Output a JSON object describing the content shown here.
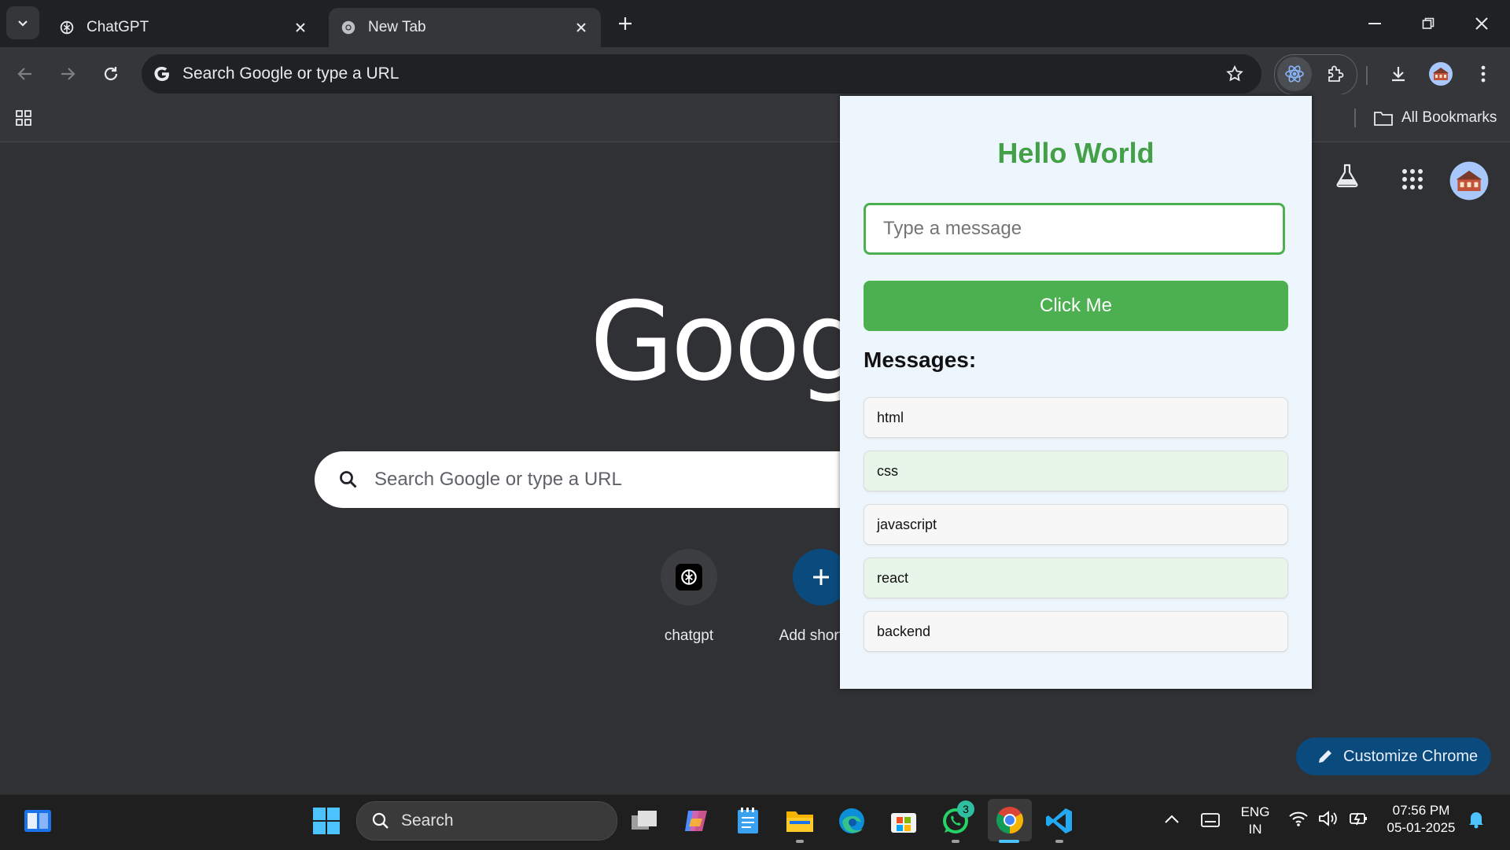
{
  "browser": {
    "tabs": [
      {
        "title": "ChatGPT",
        "active": false
      },
      {
        "title": "New Tab",
        "active": true
      }
    ],
    "omnibox_text": "Search Google or type a URL",
    "bookmarks_label": "All Bookmarks"
  },
  "ntp": {
    "logo_text": "Google",
    "search_placeholder": "Search Google or type a URL",
    "shortcuts": [
      {
        "label": "chatgpt"
      },
      {
        "label": "Add shortcut"
      }
    ],
    "customize_label": "Customize Chrome"
  },
  "popup": {
    "title": "Hello World",
    "input_placeholder": "Type a message",
    "button_label": "Click Me",
    "messages_heading": "Messages:",
    "messages": [
      "html",
      "css",
      "javascript",
      "react",
      "backend"
    ],
    "colors": {
      "accent": "#4caf50",
      "title": "#43a047",
      "background": "#eef6fd",
      "item_odd": "#f7f7f7",
      "item_even": "#e8f5e9"
    }
  },
  "taskbar": {
    "search_label": "Search",
    "whatsapp_badge": "3",
    "lang_top": "ENG",
    "lang_bottom": "IN",
    "time": "07:56 PM",
    "date": "05-01-2025"
  }
}
